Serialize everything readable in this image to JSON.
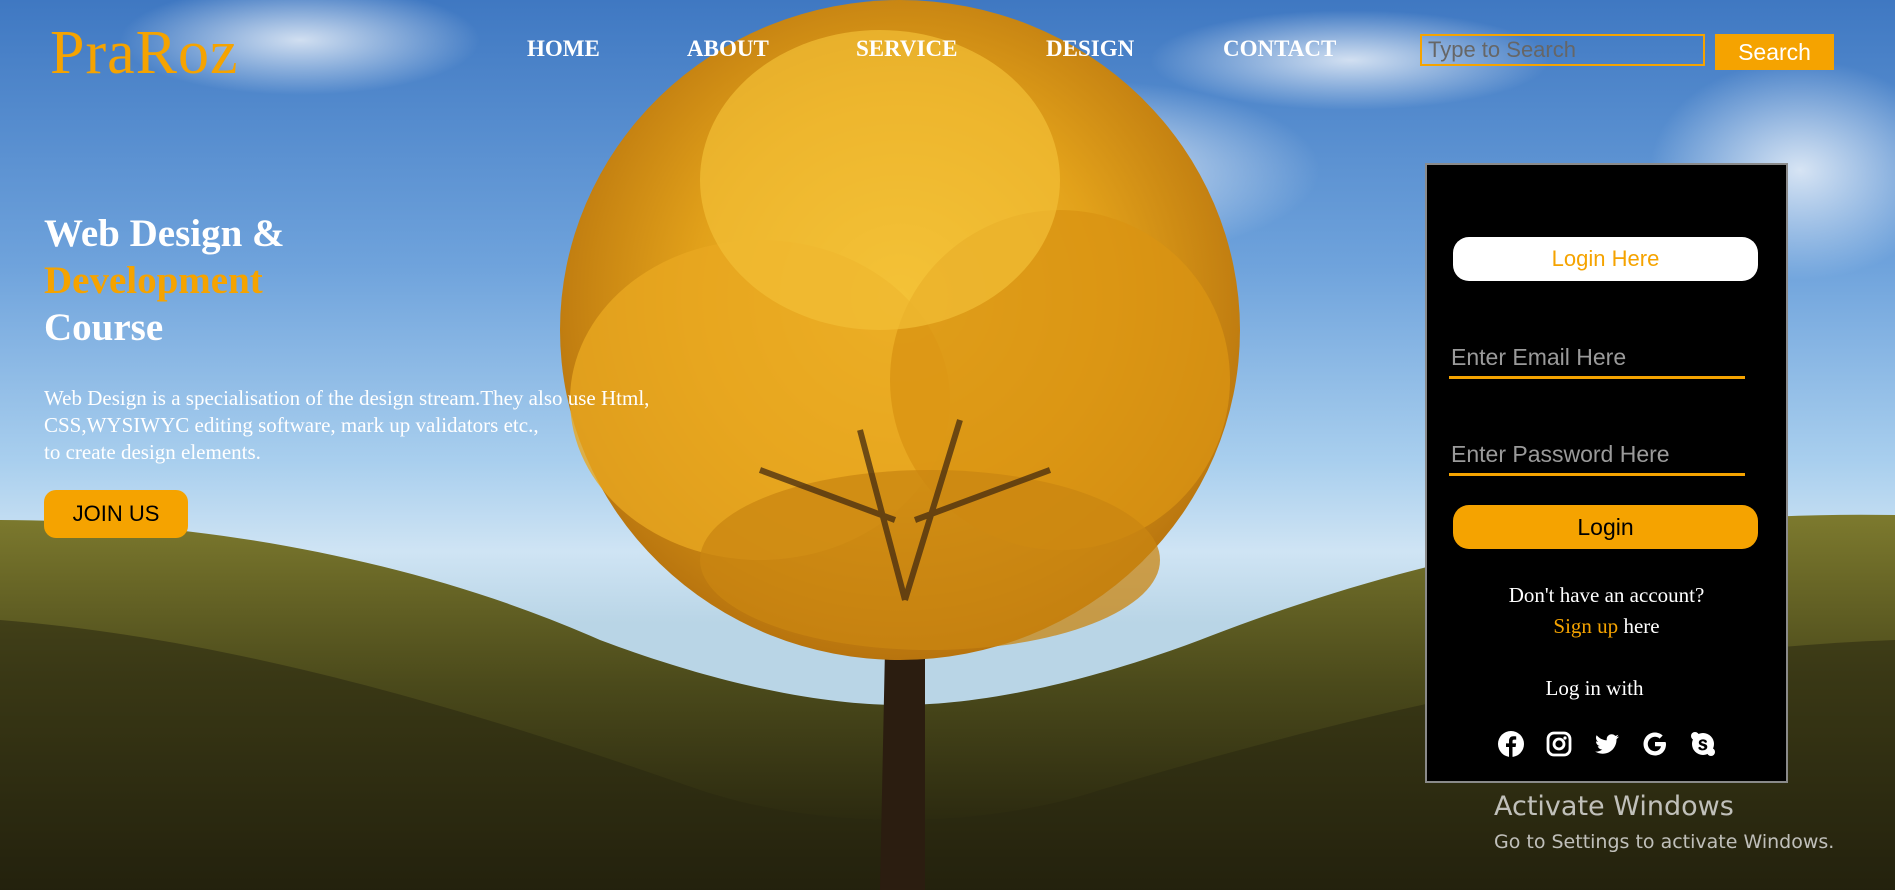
{
  "header": {
    "logo": "PraRoz",
    "nav": [
      "HOME",
      "ABOUT",
      "SERVICE",
      "DESIGN",
      "CONTACT"
    ],
    "search": {
      "placeholder": "Type to Search",
      "button": "Search"
    }
  },
  "hero": {
    "title_line1": "Web Design &",
    "title_line2": "Development",
    "title_line3": "Course",
    "text_line1": "Web Design is a specialisation of the design stream.They also use Html,",
    "text_line2": "CSS,WYSIWYC editing software, mark up validators etc.,",
    "text_line3": "to create design elements.",
    "join_button": "JOIN US"
  },
  "login": {
    "header": "Login Here",
    "email_placeholder": "Enter Email Here",
    "password_placeholder": "Enter Password Here",
    "login_button": "Login",
    "no_account": "Don't have an account?",
    "signup_link": "Sign up",
    "signup_suffix": " here",
    "login_with": "Log in with",
    "social_icons": [
      "facebook-icon",
      "instagram-icon",
      "twitter-icon",
      "google-icon",
      "skype-icon"
    ]
  },
  "watermark": {
    "line1": "Activate Windows",
    "line2": "Go to Settings to activate Windows."
  },
  "colors": {
    "accent": "#f5a300",
    "panel": "#000000",
    "text": "#ffffff"
  }
}
